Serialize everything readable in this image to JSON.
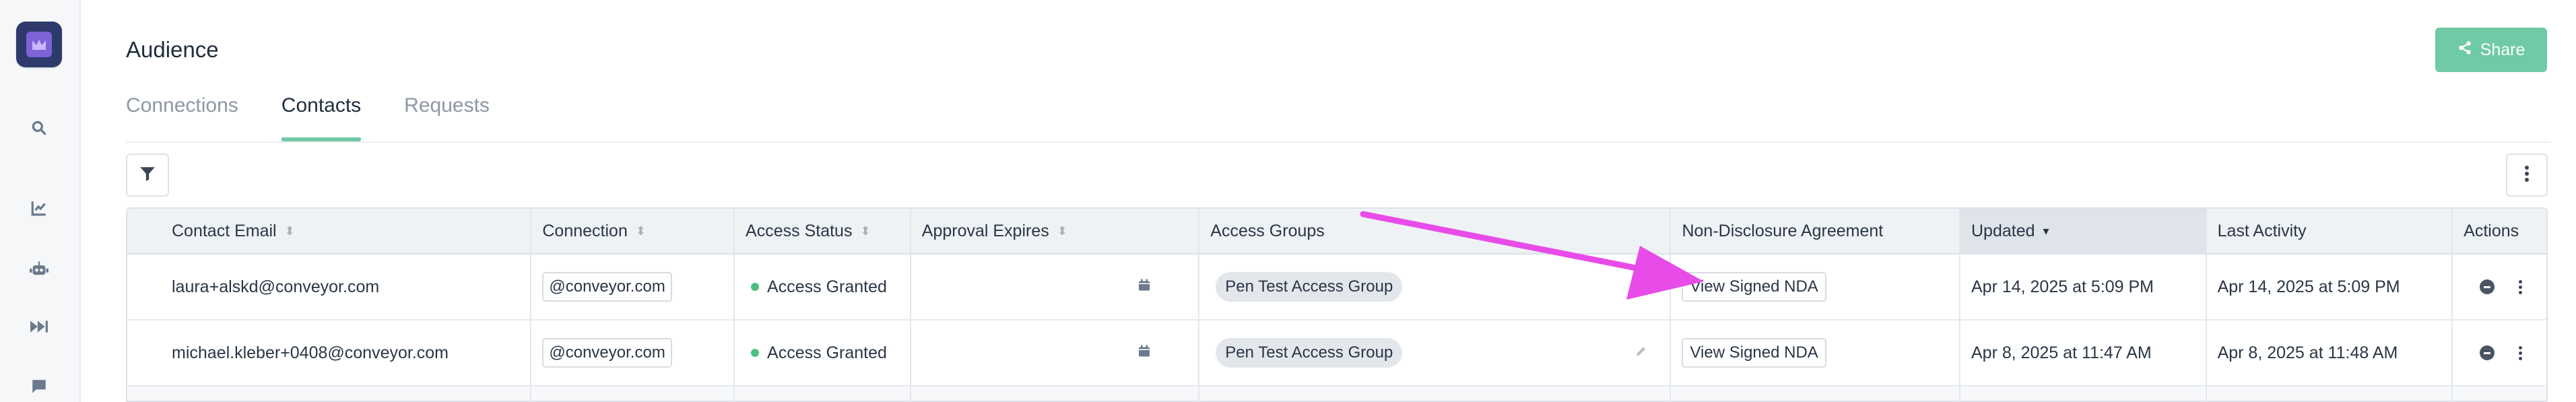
{
  "app": {
    "title": "Audience",
    "share_label": "Share"
  },
  "tabs": [
    {
      "label": "Connections",
      "active": false
    },
    {
      "label": "Contacts",
      "active": true
    },
    {
      "label": "Requests",
      "active": false
    }
  ],
  "table": {
    "columns": [
      "Contact Email",
      "Connection",
      "Access Status",
      "Approval Expires",
      "Access Groups",
      "Non-Disclosure Agreement",
      "Updated",
      "Last Activity",
      "Actions"
    ],
    "rows": [
      {
        "email": "laura+alskd@conveyor.com",
        "connection": "@conveyor.com",
        "status": "Access Granted",
        "expires": "",
        "group": "Pen Test Access Group",
        "nda": "View Signed NDA",
        "updated": "Apr 14, 2025 at 5:09 PM",
        "last_activity": "Apr 14, 2025 at 5:09 PM"
      },
      {
        "email": "michael.kleber+0408@conveyor.com",
        "connection": "@conveyor.com",
        "status": "Access Granted",
        "expires": "",
        "group": "Pen Test Access Group",
        "nda": "View Signed NDA",
        "updated": "Apr 8, 2025 at 11:47 AM",
        "last_activity": "Apr 8, 2025 at 11:48 AM"
      }
    ]
  },
  "icons": {
    "sidebar": [
      "search-icon",
      "chart-icon",
      "robot-icon",
      "fast-forward-icon",
      "chat-icon"
    ],
    "toolbar": [
      "filter-icon",
      "more-vertical-icon"
    ]
  },
  "colors": {
    "accent": "#6fcaa5",
    "status_granted": "#4bbf83",
    "annotation_arrow": "#e84ce8",
    "logo": "#2d3a6b"
  }
}
